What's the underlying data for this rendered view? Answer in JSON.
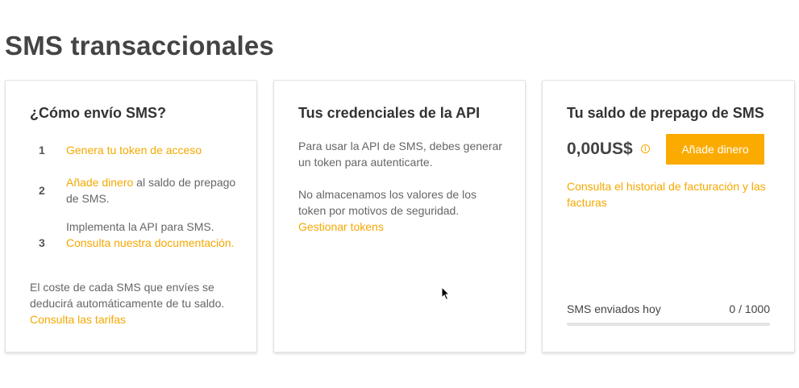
{
  "page": {
    "title": "SMS transaccionales"
  },
  "how_to": {
    "title": "¿Cómo envío SMS?",
    "steps": [
      {
        "number": "1",
        "link": "Genera tu token de acceso"
      },
      {
        "number": "2",
        "link": "Añade dinero",
        "text": " al saldo de prepago de SMS."
      },
      {
        "number": "3",
        "text": "Implementa la API para SMS. ",
        "link": "Consulta nuestra documentación."
      }
    ],
    "footer_text": "El coste de cada SMS que envíes se deducirá automáticamente de tu saldo. ",
    "footer_link": "Consulta las tarifas"
  },
  "credentials": {
    "title": "Tus credenciales de la API",
    "paragraph1": "Para usar la API de SMS, debes generar un token para autenticarte.",
    "paragraph2": "No almacenamos los valores de los token por motivos de seguridad. ",
    "manage_link": "Gestionar tokens"
  },
  "balance": {
    "title": "Tu saldo de prepago de SMS",
    "amount": "0,00US$",
    "info_icon": "info-icon",
    "add_money_label": "Añade dinero",
    "billing_link": "Consulta el historial de facturación y las facturas",
    "sms_sent_label": "SMS enviados hoy",
    "sms_sent_count": "0 / 1000",
    "sms_sent_fraction": 0
  },
  "colors": {
    "accent": "#fbab00",
    "link": "#f5a800",
    "title": "#444444",
    "text": "#666666"
  }
}
